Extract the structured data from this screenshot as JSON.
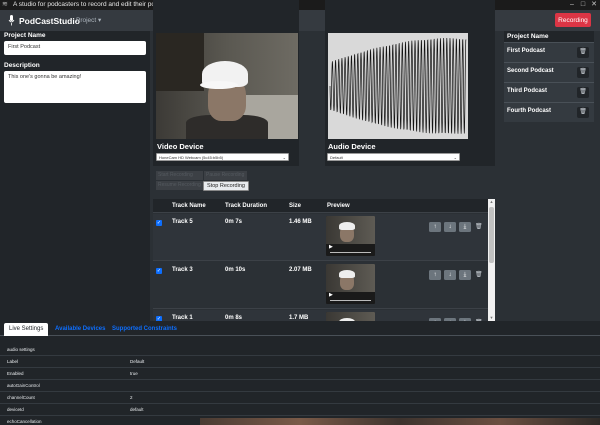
{
  "window": {
    "title": "A studio for podcasters to record and edit their podcasts - PodCastStudio",
    "app_icon": "waveform-icon",
    "minimize": "–",
    "maximize": "□",
    "close": "✕"
  },
  "navbar": {
    "brand": "PodCastStudio",
    "menu": "Project ▾",
    "record_button": "Recording"
  },
  "project_form": {
    "name_label": "Project Name",
    "name_value": "First Podcast",
    "description_label": "Description",
    "description_value": "This one's gonna be amazing!"
  },
  "devices": {
    "video_label": "Video Device",
    "video_selected": "HoneCam HD Webcam (5c45:b5b5)",
    "audio_label": "Audio Device",
    "audio_selected": "Default"
  },
  "record_controls": {
    "disabled_1": "Start Recording",
    "disabled_2": "Pause Recording",
    "disabled_3": "Resume Recording",
    "stop": "Stop Recording"
  },
  "tracks": {
    "columns": [
      "Track Name",
      "Track Duration",
      "Size",
      "Preview"
    ],
    "rows": [
      {
        "name": "Track 5",
        "duration": "0m 7s",
        "size": "1.46 MB"
      },
      {
        "name": "Track 3",
        "duration": "0m 10s",
        "size": "2.07 MB"
      },
      {
        "name": "Track 1",
        "duration": "0m 8s",
        "size": "1.7 MB"
      }
    ],
    "check": "✓",
    "up": "↑",
    "down": "↓",
    "download": "⤓",
    "trash": "🗑",
    "play": "▶",
    "scroll_up": "▲",
    "scroll_down": "▼"
  },
  "projects": {
    "header": "Project Name",
    "items": [
      "First Podcast",
      "Second Podcast",
      "Third Podcast",
      "Fourth Podcast"
    ],
    "trash": "🗑"
  },
  "settings": {
    "tabs": [
      "Live Settings",
      "Available Devices",
      "Supported Constraints"
    ],
    "rows": [
      {
        "key": "audio settings",
        "value": ""
      },
      {
        "key": "Label",
        "value": "Default"
      },
      {
        "key": "Enabled",
        "value": "true"
      },
      {
        "key": "autoGainControl",
        "value": ""
      },
      {
        "key": "channelCount",
        "value": "2"
      },
      {
        "key": "deviceId",
        "value": "default"
      },
      {
        "key": "echoCancellation",
        "value": ""
      }
    ]
  },
  "colors": {
    "accent": "#0d6efd",
    "danger": "#dc3545",
    "panel": "#212529"
  }
}
